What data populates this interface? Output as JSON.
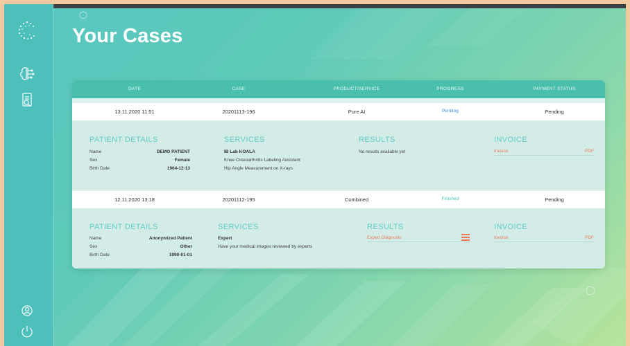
{
  "page": {
    "title": "Your Cases"
  },
  "sidebar": {
    "icons": [
      "logo-icon",
      "brain-icon",
      "document-search-icon",
      "user-settings-icon",
      "power-icon"
    ]
  },
  "table": {
    "headers": [
      "DATE",
      "CASE",
      "PRODUCT/SERVICE",
      "PROGRESS",
      "PAYMENT STATUS"
    ],
    "rows": [
      {
        "date": "13.11.2020 11:51",
        "case": "20201113-196",
        "product": "Pure AI",
        "progress": "Pending",
        "payment": "Pending",
        "details": {
          "patient_title": "PATIENT DETAILS",
          "name_label": "Name",
          "name_value": "DEMO PATIENT",
          "sex_label": "Sex",
          "sex_value": "Female",
          "birth_label": "Birth Date",
          "birth_value": "1964-12-13",
          "services_title": "SERVICES",
          "services": [
            "IB Lab KOALA",
            "Knee Osteoarthritis Labeling Assistant",
            "Hip Angle Measurement on X-rays"
          ],
          "results_title": "RESULTS",
          "results_text": "No results available yet",
          "invoice_title": "INVOICE",
          "invoice_label": "Invoice",
          "invoice_format": "PDF"
        }
      },
      {
        "date": "12.11.2020 13:18",
        "case": "20201112-195",
        "product": "Combined",
        "progress": "Finished",
        "payment": "Pending",
        "details": {
          "patient_title": "PATIENT DETAILS",
          "name_label": "Name",
          "name_value": "Anonymized Patient",
          "sex_label": "Sex",
          "sex_value": "Other",
          "birth_label": "Birth Date",
          "birth_value": "1990-01-01",
          "services_title": "SERVICES",
          "services": [
            "Expert",
            "Have your medical images reviewed by experts"
          ],
          "results_title": "RESULTS",
          "results_link": "Expert Diagnosis",
          "invoice_title": "INVOICE",
          "invoice_label": "Invoice",
          "invoice_format": "PDF"
        }
      }
    ]
  },
  "colors": {
    "accent": "#4bbfae",
    "pending_blue": "#3b86d9",
    "finished_teal": "#3fc4b6",
    "link_orange": "#ef7b55"
  }
}
